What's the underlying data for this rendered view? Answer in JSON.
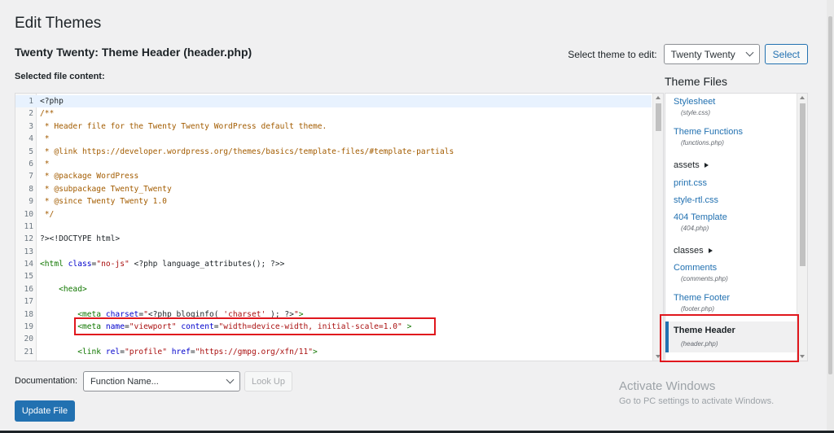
{
  "page": {
    "title": "Edit Themes",
    "file_title": "Twenty Twenty: Theme Header (header.php)",
    "selected_label": "Selected file content:"
  },
  "theme_selector": {
    "label": "Select theme to edit:",
    "value": "Twenty Twenty",
    "button": "Select"
  },
  "editor": {
    "active_line": 1,
    "highlighted_line": 19,
    "lines": [
      {
        "n": "1",
        "parts": [
          {
            "t": "<?php",
            "c": "def"
          }
        ]
      },
      {
        "n": "2",
        "parts": [
          {
            "t": "/**",
            "c": "com"
          }
        ]
      },
      {
        "n": "3",
        "parts": [
          {
            "t": " * Header file for the Twenty Twenty WordPress default theme.",
            "c": "com"
          }
        ]
      },
      {
        "n": "4",
        "parts": [
          {
            "t": " *",
            "c": "com"
          }
        ]
      },
      {
        "n": "5",
        "parts": [
          {
            "t": " * @link https://developer.wordpress.org/themes/basics/template-files/#template-partials",
            "c": "com"
          }
        ]
      },
      {
        "n": "6",
        "parts": [
          {
            "t": " *",
            "c": "com"
          }
        ]
      },
      {
        "n": "7",
        "parts": [
          {
            "t": " * @package WordPress",
            "c": "com"
          }
        ]
      },
      {
        "n": "8",
        "parts": [
          {
            "t": " * @subpackage Twenty_Twenty",
            "c": "com"
          }
        ]
      },
      {
        "n": "9",
        "parts": [
          {
            "t": " * @since Twenty Twenty 1.0",
            "c": "com"
          }
        ]
      },
      {
        "n": "10",
        "parts": [
          {
            "t": " */",
            "c": "com"
          }
        ]
      },
      {
        "n": "11",
        "parts": []
      },
      {
        "n": "12",
        "parts": [
          {
            "t": "?><!DOCTYPE html>",
            "c": "def"
          }
        ]
      },
      {
        "n": "13",
        "parts": []
      },
      {
        "n": "14",
        "parts": [
          {
            "t": "<html ",
            "c": "tag"
          },
          {
            "t": "class",
            "c": "atr"
          },
          {
            "t": "=",
            "c": "def"
          },
          {
            "t": "\"no-js\"",
            "c": "str"
          },
          {
            "t": " <?php language_attributes(); ?>>",
            "c": "def"
          }
        ]
      },
      {
        "n": "15",
        "parts": []
      },
      {
        "n": "16",
        "parts": [
          {
            "t": "    <head>",
            "c": "tag"
          }
        ]
      },
      {
        "n": "17",
        "parts": []
      },
      {
        "n": "18",
        "parts": [
          {
            "t": "        <meta ",
            "c": "tag"
          },
          {
            "t": "charset",
            "c": "atr"
          },
          {
            "t": "=",
            "c": "def"
          },
          {
            "t": "\"",
            "c": "str"
          },
          {
            "t": "<?php bloginfo( ",
            "c": "def"
          },
          {
            "t": "'charset'",
            "c": "str"
          },
          {
            "t": " ); ?>",
            "c": "def"
          },
          {
            "t": "\"",
            "c": "str"
          },
          {
            "t": ">",
            "c": "tag"
          }
        ]
      },
      {
        "n": "19",
        "parts": [
          {
            "t": "        <meta ",
            "c": "tag"
          },
          {
            "t": "name",
            "c": "atr"
          },
          {
            "t": "=",
            "c": "def"
          },
          {
            "t": "\"viewport\"",
            "c": "str"
          },
          {
            "t": " ",
            "c": "def"
          },
          {
            "t": "content",
            "c": "atr"
          },
          {
            "t": "=",
            "c": "def"
          },
          {
            "t": "\"width=device-width, initial-scale=1.0\"",
            "c": "str"
          },
          {
            "t": " >",
            "c": "tag"
          }
        ]
      },
      {
        "n": "20",
        "parts": []
      },
      {
        "n": "21",
        "parts": [
          {
            "t": "        <link ",
            "c": "tag"
          },
          {
            "t": "rel",
            "c": "atr"
          },
          {
            "t": "=",
            "c": "def"
          },
          {
            "t": "\"profile\"",
            "c": "str"
          },
          {
            "t": " ",
            "c": "def"
          },
          {
            "t": "href",
            "c": "atr"
          },
          {
            "t": "=",
            "c": "def"
          },
          {
            "t": "\"https://gmpg.org/xfn/11\"",
            "c": "str"
          },
          {
            "t": ">",
            "c": "tag"
          }
        ]
      }
    ]
  },
  "theme_files": {
    "heading": "Theme Files",
    "items": [
      {
        "type": "file",
        "label": "Stylesheet",
        "sub": "(style.css)"
      },
      {
        "type": "file",
        "label": "Theme Functions",
        "sub": "(functions.php)"
      },
      {
        "type": "folder",
        "label": "assets"
      },
      {
        "type": "file",
        "label": "print.css",
        "sub": ""
      },
      {
        "type": "file",
        "label": "style-rtl.css",
        "sub": ""
      },
      {
        "type": "file",
        "label": "404 Template",
        "sub": "(404.php)"
      },
      {
        "type": "folder",
        "label": "classes"
      },
      {
        "type": "file",
        "label": "Comments",
        "sub": "(comments.php)"
      },
      {
        "type": "file",
        "label": "Theme Footer",
        "sub": "(footer.php)"
      }
    ],
    "active": {
      "label": "Theme Header",
      "sub": "(header.php)"
    }
  },
  "documentation": {
    "label": "Documentation:",
    "select_value": "Function Name...",
    "lookup_button": "Look Up"
  },
  "update_button": "Update File",
  "watermark": {
    "line1": "Activate Windows",
    "line2": "Go to PC settings to activate Windows."
  },
  "colors": {
    "accent": "#2271b1",
    "highlight_box": "#e0171d",
    "background": "#f0f0f1"
  }
}
